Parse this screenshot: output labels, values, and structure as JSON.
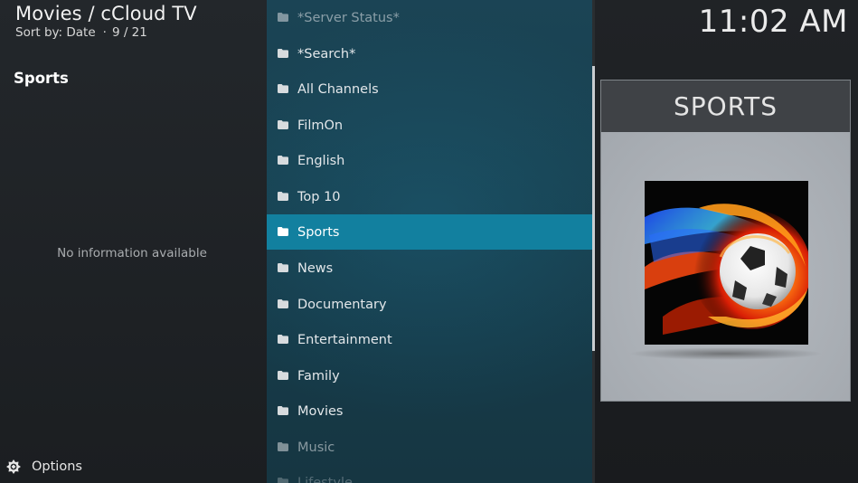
{
  "header": {
    "title": "Movies / cCloud TV",
    "sort_label": "Sort by: Date",
    "separator": "·",
    "position": "9 / 21"
  },
  "info_panel": {
    "selected_name": "Sports",
    "no_info_text": "No information available"
  },
  "footer": {
    "options_label": "Options",
    "options_icon": "options-gear-icon"
  },
  "clock": {
    "time": "11:02 AM"
  },
  "list": {
    "items": [
      {
        "label": "*Server Status*"
      },
      {
        "label": "*Search*"
      },
      {
        "label": "All Channels"
      },
      {
        "label": "FilmOn"
      },
      {
        "label": "English"
      },
      {
        "label": "Top 10"
      },
      {
        "label": "Sports"
      },
      {
        "label": "News"
      },
      {
        "label": "Documentary"
      },
      {
        "label": "Entertainment"
      },
      {
        "label": "Family"
      },
      {
        "label": "Movies"
      },
      {
        "label": "Music"
      },
      {
        "label": "Lifestyle"
      }
    ],
    "selected_index": 6,
    "item_icon": "folder-icon"
  },
  "thumbnail": {
    "title": "SPORTS",
    "image": "flaming-soccer-ball-image"
  },
  "colors": {
    "selected_row": "#12809f",
    "list_background": "#18404f",
    "panel_background": "#1b1e21",
    "thumbnail_header": "#3f4246",
    "thumbnail_body": "#a9aeb4"
  }
}
